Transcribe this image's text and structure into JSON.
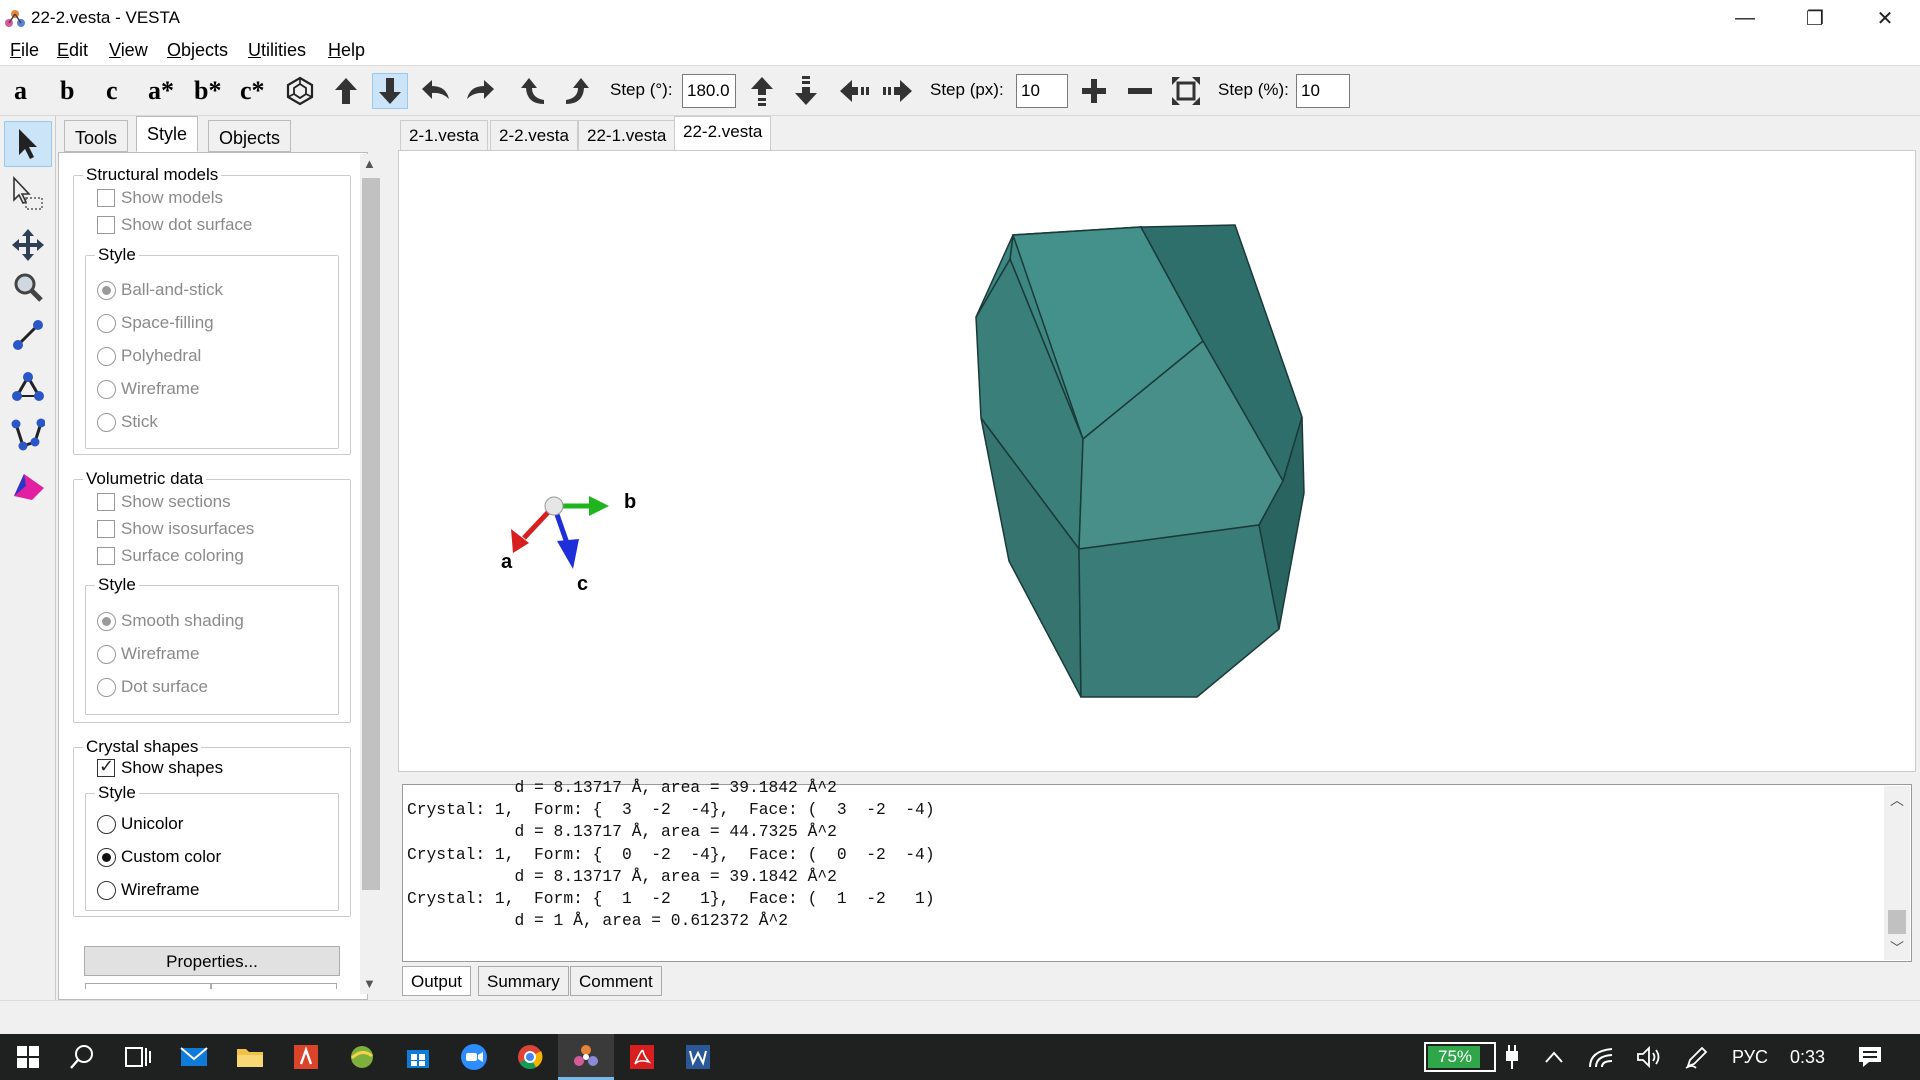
{
  "window": {
    "title": "22-2.vesta - VESTA",
    "minimize": "—",
    "restore": "❐",
    "close": "✕"
  },
  "menu": [
    {
      "label": "File",
      "mnemonic": "F",
      "rest": "ile"
    },
    {
      "label": "Edit",
      "mnemonic": "E",
      "rest": "dit"
    },
    {
      "label": "View",
      "mnemonic": "V",
      "rest": "iew"
    },
    {
      "label": "Objects",
      "mnemonic": "O",
      "rest": "bjects"
    },
    {
      "label": "Utilities",
      "mnemonic": "U",
      "rest": "tilities"
    },
    {
      "label": "Help",
      "mnemonic": "H",
      "rest": "elp"
    }
  ],
  "toolbar": {
    "axes": [
      "a",
      "b",
      "c",
      "a*",
      "b*",
      "c*"
    ],
    "step_deg_label": "Step (°):",
    "step_deg_value": "180.0",
    "step_px_label": "Step (px):",
    "step_px_value": "10",
    "step_pct_label": "Step (%):",
    "step_pct_value": "10"
  },
  "side_tabs": [
    "Tools",
    "Style",
    "Objects"
  ],
  "style_panel": {
    "structural": {
      "title": "Structural models",
      "checks": [
        {
          "label": "Show models",
          "checked": false
        },
        {
          "label": "Show dot surface",
          "checked": false
        }
      ],
      "style_title": "Style",
      "radios": [
        "Ball-and-stick",
        "Space-filling",
        "Polyhedral",
        "Wireframe",
        "Stick"
      ]
    },
    "volumetric": {
      "title": "Volumetric data",
      "checks": [
        "Show sections",
        "Show isosurfaces",
        "Surface coloring"
      ],
      "style_title": "Style",
      "radios": [
        "Smooth shading",
        "Wireframe",
        "Dot surface"
      ]
    },
    "crystal": {
      "title": "Crystal shapes",
      "check": "Show shapes",
      "style_title": "Style",
      "radios": [
        "Unicolor",
        "Custom color",
        "Wireframe"
      ]
    },
    "properties_button": "Properties..."
  },
  "doc_tabs": [
    "2-1.vesta",
    "2-2.vesta",
    "22-1.vesta",
    "22-2.vesta"
  ],
  "axes_labels": {
    "a": "a",
    "b": "b",
    "c": "c"
  },
  "colors": {
    "crystal_face": "#3f8a86",
    "axis_a": "#d81e1e",
    "axis_b": "#1eb41e",
    "axis_c": "#1e2ed8",
    "accent": "#cce4f7"
  },
  "output": {
    "lines": [
      "           d = 8.13717 Å, area = 39.1842 Å^2",
      "Crystal: 1,  Form: {  3  -2  -4},  Face: (  3  -2  -4)",
      "           d = 8.13717 Å, area = 44.7325 Å^2",
      "Crystal: 1,  Form: {  0  -2  -4},  Face: (  0  -2  -4)",
      "           d = 8.13717 Å, area = 39.1842 Å^2",
      "Crystal: 1,  Form: {  1  -2   1},  Face: (  1  -2   1)",
      "           d = 1 Å, area = 0.612372 Å^2"
    ]
  },
  "bottom_tabs": [
    "Output",
    "Summary",
    "Comment"
  ],
  "taskbar": {
    "battery": "75%",
    "language": "РУС",
    "time": "0:33"
  }
}
